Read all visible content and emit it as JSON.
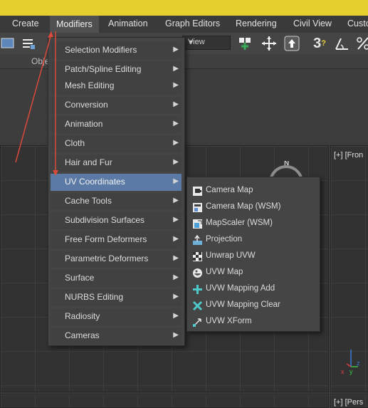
{
  "menubar": {
    "items": [
      {
        "label": "Create"
      },
      {
        "label": "Modifiers"
      },
      {
        "label": "Animation"
      },
      {
        "label": "Graph Editors"
      },
      {
        "label": "Rendering"
      },
      {
        "label": "Civil View"
      },
      {
        "label": "Custo"
      }
    ]
  },
  "toolbar": {
    "view_dropdown": "View",
    "ribbon_label": "Obje"
  },
  "viewports": {
    "right_label": "[+] [Fron",
    "bottom_right_label": "[+] [Pers",
    "compass_letter": "N",
    "axis_x": "x",
    "axis_y": "y",
    "axis_z": "z"
  },
  "modifiers_menu": {
    "items": [
      {
        "label": "Selection Modifiers",
        "submenu": true
      },
      {
        "label": "Patch/Spline Editing",
        "submenu": true
      },
      {
        "label": "Mesh Editing",
        "submenu": true
      },
      {
        "label": "Conversion",
        "submenu": true
      },
      {
        "label": "Animation",
        "submenu": true
      },
      {
        "label": "Cloth",
        "submenu": true
      },
      {
        "label": "Hair and Fur",
        "submenu": true
      },
      {
        "label": "UV Coordinates",
        "submenu": true,
        "highlighted": true
      },
      {
        "label": "Cache Tools",
        "submenu": true
      },
      {
        "label": "Subdivision Surfaces",
        "submenu": true
      },
      {
        "label": "Free Form Deformers",
        "submenu": true
      },
      {
        "label": "Parametric Deformers",
        "submenu": true
      },
      {
        "label": "Surface",
        "submenu": true
      },
      {
        "label": "NURBS Editing",
        "submenu": true
      },
      {
        "label": "Radiosity",
        "submenu": true
      },
      {
        "label": "Cameras",
        "submenu": true
      }
    ]
  },
  "uv_submenu": {
    "items": [
      {
        "label": "Camera Map",
        "icon": "camera-map-icon"
      },
      {
        "label": "Camera Map (WSM)",
        "icon": "camera-map-wsm-icon"
      },
      {
        "label": "MapScaler (WSM)",
        "icon": "mapscaler-icon"
      },
      {
        "label": "Projection",
        "icon": "projection-icon"
      },
      {
        "label": "Unwrap UVW",
        "icon": "unwrap-uvw-icon"
      },
      {
        "label": "UVW Map",
        "icon": "uvw-map-icon"
      },
      {
        "label": "UVW Mapping Add",
        "icon": "uvw-mapping-add-icon"
      },
      {
        "label": "UVW Mapping Clear",
        "icon": "uvw-mapping-clear-icon"
      },
      {
        "label": "UVW XForm",
        "icon": "uvw-xform-icon"
      }
    ]
  },
  "colors": {
    "highlight": "#5b7ba6",
    "annotation_arrow": "#d94a3a",
    "title_strip": "#e4cf2f"
  }
}
